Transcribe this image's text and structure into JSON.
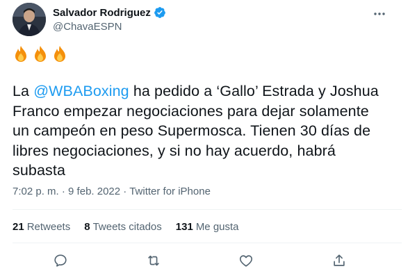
{
  "author": {
    "display_name": "Salvador Rodriguez",
    "handle": "@ChavaESPN",
    "verified_icon": "verified-badge-icon",
    "verified_color": "#1d9bf0"
  },
  "tweet": {
    "emojis": [
      "🔥",
      "🔥",
      "🔥"
    ],
    "text_prefix": "La ",
    "mention": "@WBABoxing",
    "text_suffix": " ha pedido a ‘Gallo’ Estrada y Joshua Franco empezar negociaciones para dejar solamente un campeón en peso Supermosca. Tienen 30 días de libres negociaciones, y si no hay acuerdo, habrá subasta",
    "time": "7:02 p. m.",
    "separator": "·",
    "date": "9 feb. 2022",
    "source": "Twitter for iPhone"
  },
  "stats": {
    "retweets_count": "21",
    "retweets_label": "Retweets",
    "quotes_count": "8",
    "quotes_label": "Tweets citados",
    "likes_count": "131",
    "likes_label": "Me gusta"
  },
  "actions": [
    "reply-icon",
    "retweet-icon",
    "like-icon",
    "share-icon"
  ],
  "colors": {
    "accent": "#1d9bf0",
    "secondary_text": "#536471",
    "primary_text": "#0f1419",
    "divider": "#eff3f4"
  }
}
